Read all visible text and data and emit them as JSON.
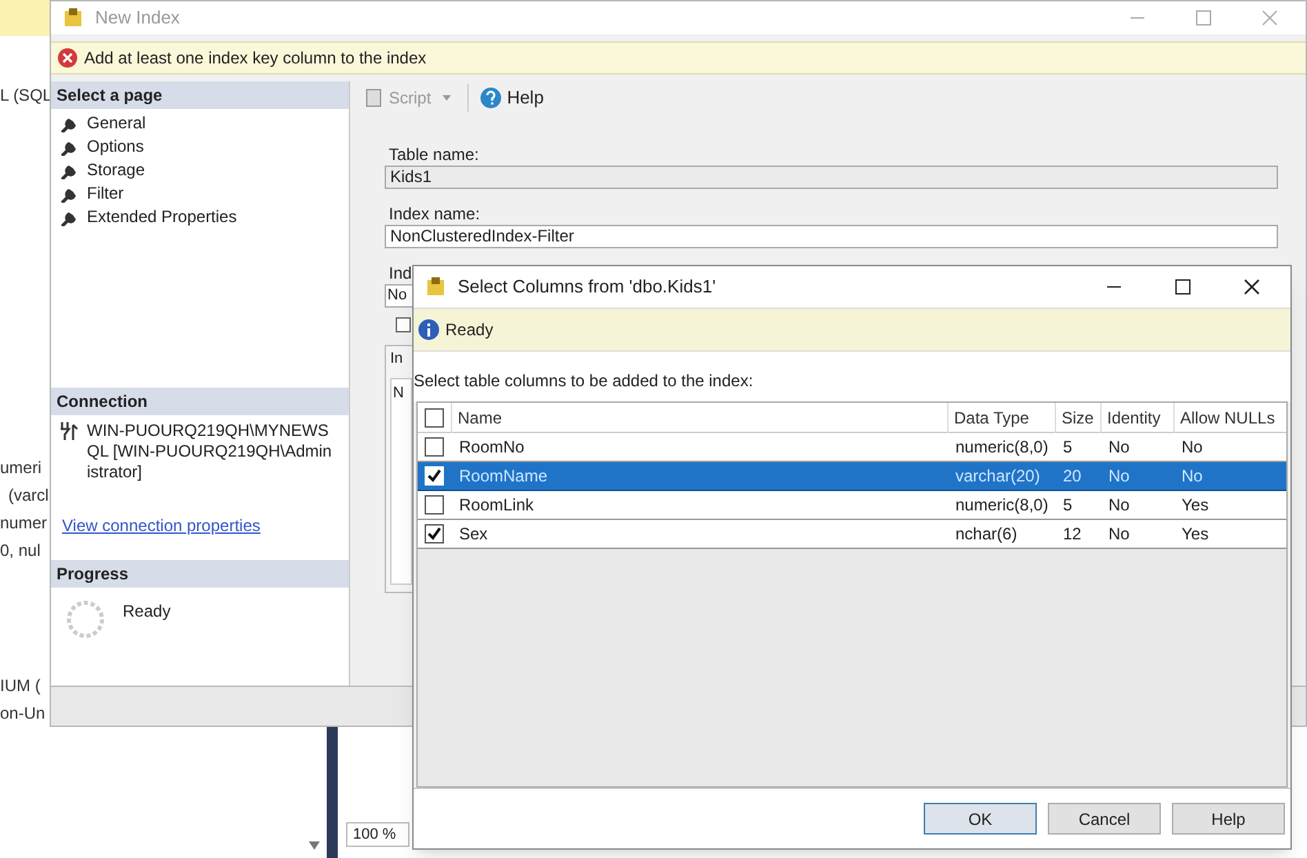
{
  "background_app": {
    "fragments": [
      "L (SQL",
      "umeri",
      "(varcl",
      "numer",
      "0, nul",
      "IUM (",
      "on-Un"
    ],
    "zoom": "100 %"
  },
  "new_index": {
    "title": "New Index",
    "error": "Add at least one index key column to the index",
    "select_page": {
      "header": "Select a page",
      "items": [
        "General",
        "Options",
        "Storage",
        "Filter",
        "Extended Properties"
      ]
    },
    "connection": {
      "header": "Connection",
      "server": "WIN-PUOURQ219QH\\MYNEWSQL [WIN-PUOURQ219QH\\Administrator]",
      "link": "View connection properties"
    },
    "progress": {
      "header": "Progress",
      "status": "Ready"
    },
    "toolbar": {
      "script": "Script",
      "help": "Help"
    },
    "table_name": {
      "label": "Table name:",
      "value": "Kids1"
    },
    "index_name": {
      "label": "Index name:",
      "value": "NonClusteredIndex-Filter"
    },
    "hidden_fragments": {
      "label": "Ind",
      "field": "No",
      "checked": false,
      "group": "In",
      "column": "N"
    }
  },
  "select_columns": {
    "title": "Select Columns from 'dbo.Kids1'",
    "status": "Ready",
    "instruction": "Select table columns to be added to the index:",
    "header_checked": false,
    "columns": [
      "Name",
      "Data Type",
      "Size",
      "Identity",
      "Allow NULLs"
    ],
    "rows": [
      {
        "checked": false,
        "selected": false,
        "cells": [
          "RoomNo",
          "numeric(8,0)",
          "5",
          "No",
          "No"
        ]
      },
      {
        "checked": true,
        "selected": true,
        "cells": [
          "RoomName",
          "varchar(20)",
          "20",
          "No",
          "No"
        ]
      },
      {
        "checked": false,
        "selected": false,
        "cells": [
          "RoomLink",
          "numeric(8,0)",
          "5",
          "No",
          "Yes"
        ]
      },
      {
        "checked": true,
        "selected": false,
        "cells": [
          "Sex",
          "nchar(6)",
          "12",
          "No",
          "Yes"
        ]
      }
    ],
    "buttons": [
      "OK",
      "Cancel",
      "Help"
    ]
  }
}
